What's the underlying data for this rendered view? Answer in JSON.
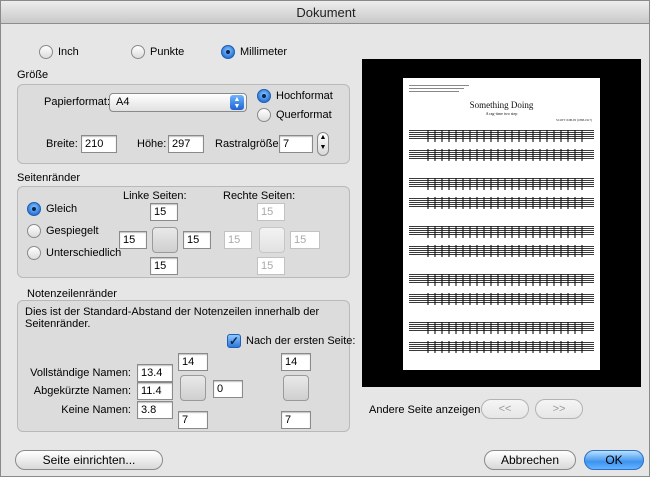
{
  "window": {
    "title": "Dokument"
  },
  "units": {
    "inch": "Inch",
    "punkte": "Punkte",
    "millimeter": "Millimeter",
    "selected": "Millimeter"
  },
  "groesse": {
    "label": "Größe",
    "papierformat_label": "Papierformat:",
    "papierformat_value": "A4",
    "hochformat": "Hochformat",
    "querformat": "Querformat",
    "orientation_selected": "Hochformat",
    "breite_label": "Breite:",
    "breite_value": "210",
    "hoehe_label": "Höhe:",
    "hoehe_value": "297",
    "rastral_label": "Rastralgröße:",
    "rastral_value": "7"
  },
  "seitenraender": {
    "label": "Seitenränder",
    "gleich": "Gleich",
    "gespiegelt": "Gespiegelt",
    "unterschiedlich": "Unterschiedlich",
    "selected": "Gleich",
    "linke_label": "Linke Seiten:",
    "rechte_label": "Rechte Seiten:",
    "links": {
      "top": "15",
      "left": "15",
      "right": "15",
      "bottom": "15"
    },
    "rechts": {
      "top": "15",
      "left": "15",
      "right": "15",
      "bottom": "15"
    }
  },
  "notenzeilenraender": {
    "label": "Notenzeilenränder",
    "description": "Dies ist der Standard-Abstand der Notenzeilen innerhalb der Seitenränder.",
    "nach_erster_seite_label": "Nach der ersten Seite:",
    "nach_erster_seite_checked": true,
    "vollstaendige_label": "Vollständige Namen:",
    "vollstaendige_value": "13.4",
    "abgekuerzte_label": "Abgekürzte Namen:",
    "abgekuerzte_value": "11.4",
    "keine_label": "Keine Namen:",
    "keine_value": "3.8",
    "first_page": {
      "top": "14",
      "right": "0",
      "bottom": "7"
    },
    "after_first": {
      "top": "14",
      "bottom": "7"
    }
  },
  "preview": {
    "score_title": "Something Doing",
    "score_subtitle": "A rag-time two step",
    "composer": "SCOTT JOPLIN (1868-1917)",
    "andere_seite_label": "Andere Seite anzeigen",
    "prev_label": "<<",
    "next_label": ">>"
  },
  "footer": {
    "seite_einrichten": "Seite einrichten...",
    "abbrechen": "Abbrechen",
    "ok": "OK"
  },
  "colors": {
    "accent": "#2c78d8",
    "window_bg": "#e6e6e6",
    "group_bg": "#dcdcdc"
  }
}
